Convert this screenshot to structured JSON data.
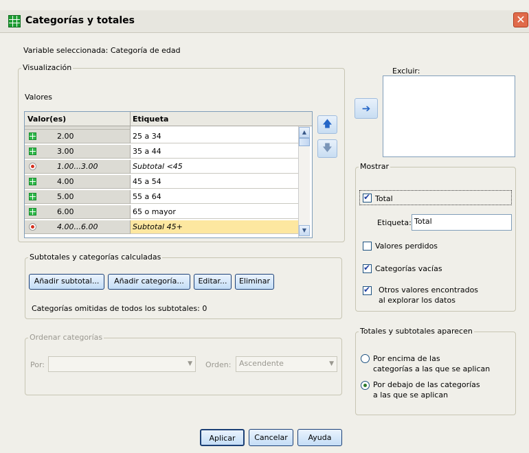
{
  "window": {
    "title": "Categorías y totales",
    "close_glyph": "✕"
  },
  "selected_variable": "Variable seleccionada: Categoría de edad",
  "display": {
    "legend": "Visualización",
    "values_label": "Valores",
    "col_value": "Valor(es)",
    "col_label": "Etiqueta",
    "rows": [
      {
        "kind": "category",
        "value": "2.00",
        "label": "25 a 34"
      },
      {
        "kind": "category",
        "value": "3.00",
        "label": "35 a 44"
      },
      {
        "kind": "subtotal",
        "value": "1.00...3.00",
        "label": "Subtotal <45"
      },
      {
        "kind": "category",
        "value": "4.00",
        "label": "45 a 54"
      },
      {
        "kind": "category",
        "value": "5.00",
        "label": "55 a 64"
      },
      {
        "kind": "category",
        "value": "6.00",
        "label": "65 o mayor"
      },
      {
        "kind": "subtotal",
        "value": "4.00...6.00",
        "label": "Subtotal 45+",
        "selected": true
      }
    ],
    "move_up_glyph": "🡅",
    "move_down_glyph": "🡇"
  },
  "subtotals": {
    "legend": "Subtotales y categorías calculadas",
    "add_subtotal": "Añadir subtotal...",
    "add_category": "Añadir categoría...",
    "edit": "Editar...",
    "remove": "Eliminar",
    "omitted_text": "Categorías omitidas de todos los subtotales: 0"
  },
  "sort": {
    "legend": "Ordenar categorías",
    "by_label": "Por:",
    "by_value": "",
    "order_label": "Orden:",
    "order_value": "Ascendente"
  },
  "exclude": {
    "label": "Excluir:",
    "move_glyph": "➔"
  },
  "show": {
    "legend": "Mostrar",
    "total": {
      "label": "Total",
      "checked": true
    },
    "total_label_caption": "Etiqueta:",
    "total_label_value": "Total",
    "missing": {
      "label": "Valores perdidos",
      "checked": false
    },
    "empty": {
      "label": "Categorías vacías",
      "checked": true
    },
    "other_line1": "Otros valores encontrados",
    "other_line2": "al explorar los datos",
    "other_checked": true
  },
  "position": {
    "legend": "Totales y subtotales aparecen",
    "above_line1": "Por encima de las",
    "above_line2": "categorías a las que se aplican",
    "below_line1": "Por debajo de las categorías",
    "below_line2": "a las que se aplican",
    "selected": "below"
  },
  "buttons": {
    "apply": "Aplicar",
    "cancel": "Cancelar",
    "help": "Ayuda"
  },
  "colors": {
    "selected_row": "#fde7a0",
    "title_icon": "#1f9d34",
    "accent": "#2566c7"
  }
}
